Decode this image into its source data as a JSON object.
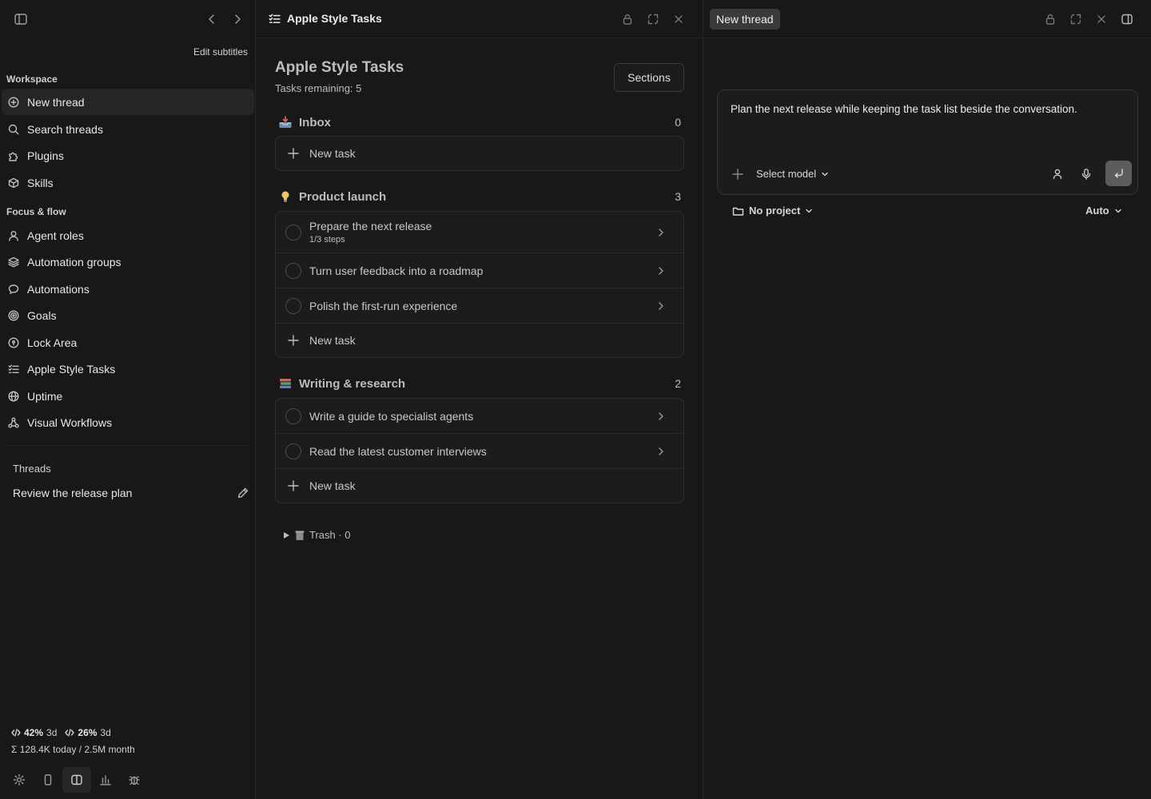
{
  "sidebar": {
    "edit_subtitles": "Edit subtitles",
    "workspace_label": "Workspace",
    "workspace_items": [
      {
        "label": "New thread",
        "icon": "plus-circle-icon",
        "active": true
      },
      {
        "label": "Search threads",
        "icon": "search-icon"
      },
      {
        "label": "Plugins",
        "icon": "puzzle-icon"
      },
      {
        "label": "Skills",
        "icon": "cube-icon"
      }
    ],
    "focus_label": "Focus & flow",
    "focus_items": [
      {
        "label": "Agent roles",
        "icon": "person-icon"
      },
      {
        "label": "Automation groups",
        "icon": "layers-icon"
      },
      {
        "label": "Automations",
        "icon": "chat-bubble-icon"
      },
      {
        "label": "Goals",
        "icon": "target-icon"
      },
      {
        "label": "Lock Area",
        "icon": "lock-circle-icon"
      },
      {
        "label": "Apple Style Tasks",
        "icon": "checklist-icon"
      },
      {
        "label": "Uptime",
        "icon": "globe-icon"
      },
      {
        "label": "Visual Workflows",
        "icon": "workflow-icon"
      }
    ],
    "threads_label": "Threads",
    "thread_item": "Review the release plan",
    "usage": {
      "a_pct": "42%",
      "a_period": "3d",
      "b_pct": "26%",
      "b_period": "3d",
      "tokens": "Σ 128.4K today / 2.5M month"
    }
  },
  "tasks": {
    "header_title": "Apple Style Tasks",
    "page_title": "Apple Style Tasks",
    "remaining": "Tasks remaining: 5",
    "sections_button": "Sections",
    "new_task_label": "New task",
    "sections": [
      {
        "name": "Inbox",
        "count": "0",
        "emoji": "inbox-tray-icon",
        "tasks": []
      },
      {
        "name": "Product launch",
        "count": "3",
        "emoji": "lightbulb-icon",
        "tasks": [
          {
            "title": "Prepare the next release",
            "sub": "1/3 steps"
          },
          {
            "title": "Turn user feedback into a roadmap"
          },
          {
            "title": "Polish the first-run experience"
          }
        ]
      },
      {
        "name": "Writing & research",
        "count": "2",
        "emoji": "books-icon",
        "tasks": [
          {
            "title": "Write a guide to specialist agents"
          },
          {
            "title": "Read the latest customer interviews"
          }
        ]
      }
    ],
    "trash": "Trash · 0"
  },
  "thread": {
    "tab_label": "New thread",
    "composer_text": "Plan the next release while keeping the task list beside the conversation.",
    "model_select": "Select model",
    "project": "No project",
    "mode": "Auto"
  }
}
